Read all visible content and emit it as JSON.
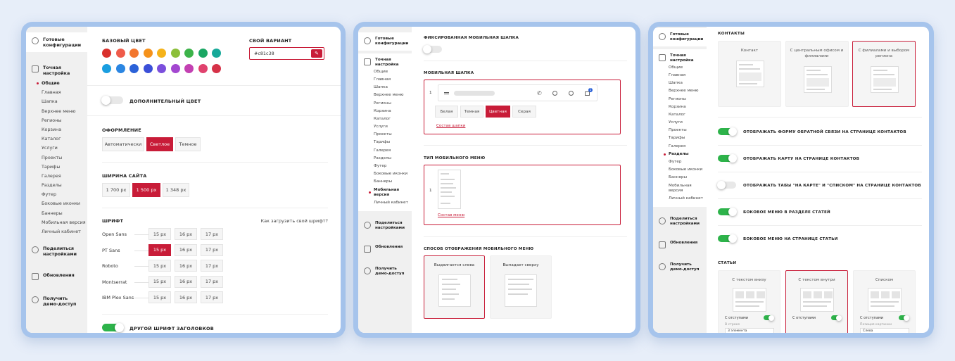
{
  "colors": {
    "accent": "#c81c38",
    "toggle_on": "#2db34a",
    "palette": [
      "#d9302c",
      "#ef5b4a",
      "#f2762e",
      "#f5921b",
      "#f5b31a",
      "#8cbf3a",
      "#3cb34a",
      "#1aa663",
      "#17a999",
      "#1a9ee0",
      "#2b86e2",
      "#2b62d8",
      "#3b4fd8",
      "#7b4fdc",
      "#a347d0",
      "#c341b2",
      "#e0426e",
      "#d63248"
    ]
  },
  "sidebar": {
    "ready_configs": "Готовые конфигурации",
    "fine_tune": "Точная настройка",
    "share": "Поделиться настройками",
    "updates": "Обновления",
    "demo": "Получить демо-доступ",
    "items": [
      "Общие",
      "Главная",
      "Шапка",
      "Верхнее меню",
      "Регионы",
      "Корзина",
      "Каталог",
      "Услуги",
      "Проекты",
      "Тарифы",
      "Галерея",
      "Разделы",
      "Футер",
      "Боковые иконки",
      "Баннеры",
      "Мобильная версия",
      "Личный кабинет"
    ]
  },
  "panel1": {
    "base_color": "Базовый цвет",
    "own_variant": "Свой вариант",
    "hex_value": "#c81c38",
    "extra_color": "Дополнительный цвет",
    "design": "Оформление",
    "design_opts": [
      "Автоматически",
      "Светлое",
      "Темное"
    ],
    "site_width": "Ширина сайта",
    "width_opts": [
      "1 700 px",
      "1 500 px",
      "1 348 px"
    ],
    "font": "Шрифт",
    "font_link": "Как загрузить свой шрифт?",
    "fonts": [
      {
        "name": "Open Sans",
        "sizes": [
          "15 px",
          "16 px",
          "17 px"
        ]
      },
      {
        "name": "PT Sans",
        "sizes": [
          "15 px",
          "16 px",
          "17 px"
        ]
      },
      {
        "name": "Roboto",
        "sizes": [
          "15 px",
          "16 px",
          "17 px"
        ]
      },
      {
        "name": "Montserrat",
        "sizes": [
          "15 px",
          "16 px",
          "17 px"
        ]
      },
      {
        "name": "IBM Plex Sans",
        "sizes": [
          "15 px",
          "16 px",
          "17 px"
        ]
      }
    ],
    "other_font": "Другой шрифт заголовков"
  },
  "panel2": {
    "fixed_header": "Фиксированная мобильная шапка",
    "mobile_header": "Мобильная шапка",
    "num": "1",
    "badge": "1",
    "header_opts": [
      "Белая",
      "Темная",
      "Цветная",
      "Серая"
    ],
    "header_link": "Состав шапки",
    "menu_type": "Тип мобильного меню",
    "menu_link": "Состав меню",
    "display_mode": "Способ отображения мобильного меню",
    "mode_left": "Выдвигается слева",
    "mode_top": "Выпадает сверху"
  },
  "panel3": {
    "contacts": "Контакты",
    "contact_cards": [
      "Контакт",
      "С центральным офисом и филиалами",
      "С филиалами и выбором региона"
    ],
    "toggles": [
      {
        "label": "Отображать форму обратной связи на странице контактов",
        "on": true
      },
      {
        "label": "Отображать карту на странице контактов",
        "on": true
      },
      {
        "label": "Отображать табы \"на карте\" и \"списком\" на странице контактов",
        "on": false
      },
      {
        "label": "Боковое меню в разделе статей",
        "on": true
      },
      {
        "label": "Боковое меню на странице статьи",
        "on": true
      }
    ],
    "articles": "Статьи",
    "article_cards": [
      "С текстом внизу",
      "С текстом внутри",
      "Списком"
    ],
    "with_padding": "С отступами",
    "in_row": "В строке",
    "in_row_val": "3 элемента",
    "img_pos": "Позиция картинки",
    "img_pos_val": "Слева"
  }
}
